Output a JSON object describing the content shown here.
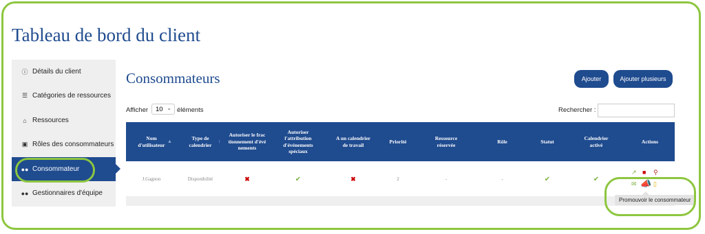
{
  "page_title": "Tableau de bord du client",
  "sidebar": {
    "items": [
      {
        "label": "Détails du client",
        "icon": "info-circle-icon"
      },
      {
        "label": "Catégories de ressources",
        "icon": "layers-icon"
      },
      {
        "label": "Ressources",
        "icon": "home-icon"
      },
      {
        "label": "Rôles des consommateurs",
        "icon": "id-badge-icon"
      },
      {
        "label": "Consommateur",
        "icon": "users-icon",
        "active": true
      },
      {
        "label": "Gestionnaires d'équipe",
        "icon": "users-icon"
      }
    ]
  },
  "main": {
    "title": "Consommateurs",
    "add_button": "Ajouter",
    "add_many_button": "Ajouter plusieurs",
    "show_prefix": "Afficher",
    "show_value": "10",
    "show_suffix": "éléments",
    "search_label": "Rechercher :",
    "search_value": ""
  },
  "table": {
    "headers": [
      "Nom d'utilisateur",
      "Type de calendrier",
      "Autoriser le fractionnement d'événements",
      "Autoriser l'attribution d'événements spéciaux",
      "A un calendrier de travail",
      "Priorité",
      "Ressource réservée",
      "Rôle",
      "Statut",
      "Calendrier activé",
      "Actions"
    ],
    "rows": [
      {
        "username": "J.Gagnon",
        "calendar_type": "Disponibilité",
        "allow_split": false,
        "allow_special": true,
        "has_work_calendar": false,
        "priority": "2",
        "reserved_resource": "-",
        "role": "-",
        "status": true,
        "calendar_enabled": true
      }
    ]
  },
  "tooltip": "Promouvoir le consommateur",
  "colors": {
    "primary": "#1f4b8f",
    "highlight": "#8dc63f",
    "danger": "#cc0000",
    "success": "#7cb342"
  }
}
